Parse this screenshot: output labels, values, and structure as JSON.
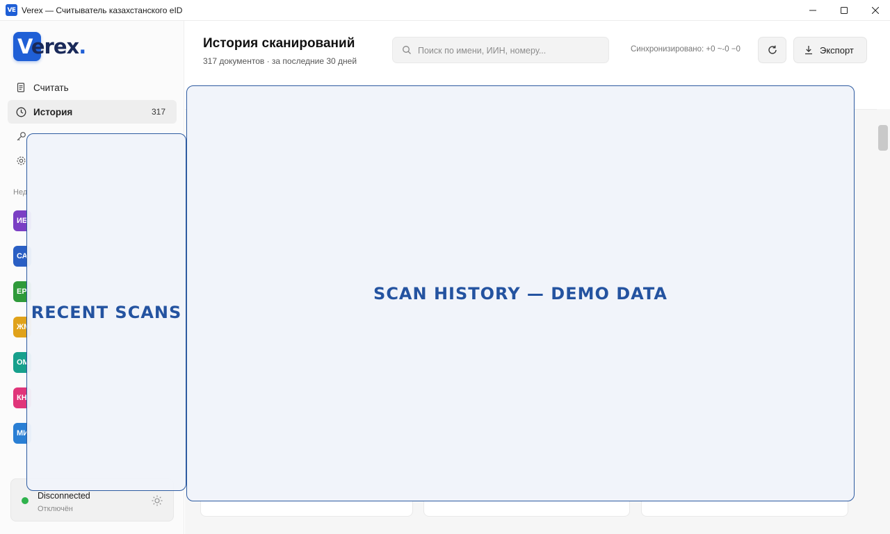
{
  "window": {
    "app_icon_text": "VE",
    "title": "Verex — Считыватель казахстанского eID"
  },
  "logo": {
    "text_v": "V",
    "text_rest": "erex",
    "dot": "."
  },
  "sidebar": {
    "items": [
      {
        "label": "Считать",
        "icon": "document-icon"
      },
      {
        "label": "История",
        "icon": "clock-icon",
        "count": "317",
        "active": true
      },
      {
        "label": "",
        "icon": "key-icon"
      },
      {
        "label": "",
        "icon": "gear-icon"
      }
    ],
    "section_label": "Нед",
    "recent": [
      {
        "initials": "ИБ",
        "color": "#7b3fc4"
      },
      {
        "initials": "СА",
        "color": "#2a5fc4"
      },
      {
        "initials": "ЕР",
        "color": "#2f9a3a"
      },
      {
        "initials": "ЖМ",
        "color": "#e0a21a"
      },
      {
        "initials": "ОМ",
        "color": "#17a08c"
      },
      {
        "initials": "КН",
        "color": "#e0357a"
      },
      {
        "initials": "МИ",
        "color": "#2a7fd4"
      }
    ],
    "status": {
      "title": "Disconnected",
      "subtitle": "Отключён",
      "dot_color": "#2fb24c"
    }
  },
  "header": {
    "title": "История сканирований",
    "subtitle": "317 документов · за последние 30 дней",
    "search_placeholder": "Поиск по имени, ИИН, номеру...",
    "sync_text": "Синхронизировано: +0 ~-0 −0",
    "export_label": "Экспорт"
  },
  "overlays": {
    "left": "RECENT SCANS",
    "main": "SCAN HISTORY — DEMO DATA"
  }
}
